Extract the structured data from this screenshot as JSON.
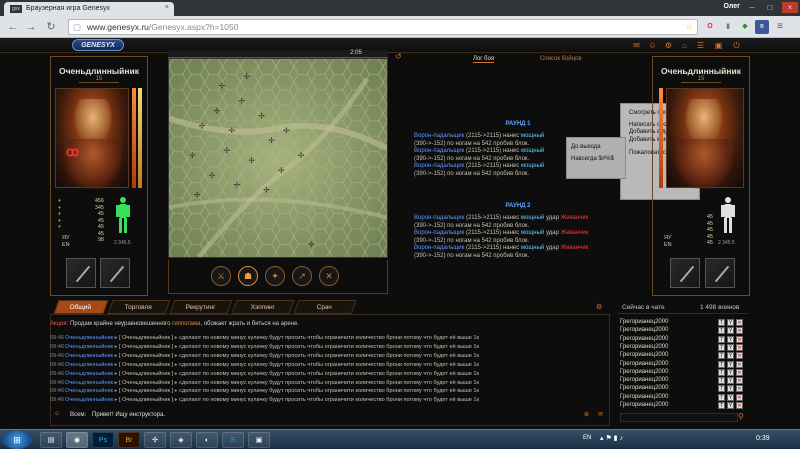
{
  "browser": {
    "tab_title": "Браузерная игра Genesyx",
    "tab_close": "×",
    "favicon_text": "gsx",
    "user_name": "Олег",
    "window_min": "–",
    "window_max": "□",
    "window_close": "×",
    "back_icon": "←",
    "forward_icon": "→",
    "reload_icon": "↻",
    "url_host": "www.genesyx.ru",
    "url_path": "/Genesyx.aspx?h=1050"
  },
  "game": {
    "logo": "GENESYX",
    "timer": "2:05",
    "log_tabs": [
      "Лог боя",
      "Список бойцов"
    ],
    "left_player": {
      "name": "Оченьдлинныйник",
      "level": "15",
      "stats": [
        "456",
        "345",
        "45",
        "45",
        "45",
        "45",
        "98"
      ],
      "stat_labels": [
        "",
        "",
        "",
        "",
        "",
        "ЯУ",
        "ЕN"
      ],
      "hp": "2 345.5"
    },
    "right_player": {
      "name": "Оченьдлинныйник",
      "level": "15",
      "stats": [
        "45",
        "45",
        "45",
        "45",
        "45"
      ],
      "stat_labels": [
        "ЯУ",
        "ЕN"
      ],
      "hp": "2 345.5"
    },
    "round1": "РАУНД 1",
    "round2": "РАУНД 2",
    "log": {
      "attacker": "Ворон-падальщик",
      "attacker_stats": "(2115->2115) нанес ",
      "strong": "мощный",
      "hit": " удар ",
      "victim": "Жеванчик",
      "damage": "(390->-152) по ногам на 542 пробив блок."
    },
    "context_menu": [
      "Смотреть профиль",
      "Написать сообщение",
      "Добавить в друзья",
      "Добавить в игнор",
      "Пожаловаться"
    ],
    "context_sub": [
      "До выхода",
      "Навсегда $#%$"
    ]
  },
  "chat": {
    "tabs": [
      "Общий",
      "Торговля",
      "Рекрутинг",
      "Хэппинг",
      "Срач"
    ],
    "promo_label": "Акция:",
    "promo_text": " Продам крайне неуравновешенного ",
    "promo_link": "гиппогама",
    "promo_tail": ", обожает жрать и биться на арене.",
    "messages": [
      {
        "time": "09:46",
        "from": "Оченьдлинныйник",
        "to": "[ Оченьдлинныйник ]",
        "text": "сделают по новому минус кулачку будут просить чтобы ограничити количество брони потому что будет её выше 1к"
      },
      {
        "time": "09:46",
        "from": "Оченьдлинныйник",
        "to": "[ Оченьдлинныйник ]",
        "text": "сделают по новому минус кулачку будут просить чтобы ограничити количество брони потому что будет её выше 1к"
      },
      {
        "time": "09:46",
        "from": "Оченьдлинныйник",
        "to": "[ Оченьдлинныйник ]",
        "text": "сделают по новому минус кулачку будут просить чтобы ограничити количество брони потому что будет её выше 1к"
      },
      {
        "time": "09:46",
        "from": "Оченьдлинныйник",
        "to": "[ Оченьдлинныйник ]",
        "text": "сделают по новому минус кулачку будут просить чтобы ограничити количество брони потому что будет её выше 1к"
      },
      {
        "time": "09:46",
        "from": "Оченьдлинныйник",
        "to": "[ Оченьдлинныйник ]",
        "text": "сделают по новому минус кулачку будут просить чтобы ограничити количество брони потому что будет её выше 1к"
      },
      {
        "time": "09:46",
        "from": "Оченьдлинныйник",
        "to": "[ Оченьдлинныйник ]",
        "text": "сделают по новому минус кулачку будут просить чтобы ограничити количество брони потому что будет её выше 1к"
      },
      {
        "time": "09:46",
        "from": "Оченьдлинныйник",
        "to": "[ Оченьдлинныйник ]",
        "text": "сделают по новому минус кулачку будут просить чтобы ограничити количество брони потому что будет её выше 1к"
      },
      {
        "time": "09:46",
        "from": "Оченьдлинныйник",
        "to": "[ Оченьдлинныйник ]",
        "text": "сделают по новому минус кулачку будут просить чтобы ограничити количество брони потому что будет её выше 1к"
      }
    ],
    "input_label": "Всем:",
    "input_value": "Привет! Ищу инструктора."
  },
  "online": {
    "title": "Сейчас в чате",
    "count": "1 498 воинов",
    "users": [
      "Грегорианец2000",
      "Грегорианец2000",
      "Грегорианец2000",
      "Грегорианец2000",
      "Грегорианец2000",
      "Грегорианец2000",
      "Грегорианец2000",
      "Грегорианец2000",
      "Грегорианец2000",
      "Грегорианец2000",
      "Грегорианец2000"
    ],
    "btn_t": "T",
    "btn_y": "Y",
    "btn_x": "✕"
  },
  "taskbar": {
    "start": "⊞",
    "lang": "EN",
    "clock": "0:39"
  },
  "colors": {
    "accent": "#a54a16",
    "name": "#5a9cff",
    "danger": "#ff3a3a"
  }
}
